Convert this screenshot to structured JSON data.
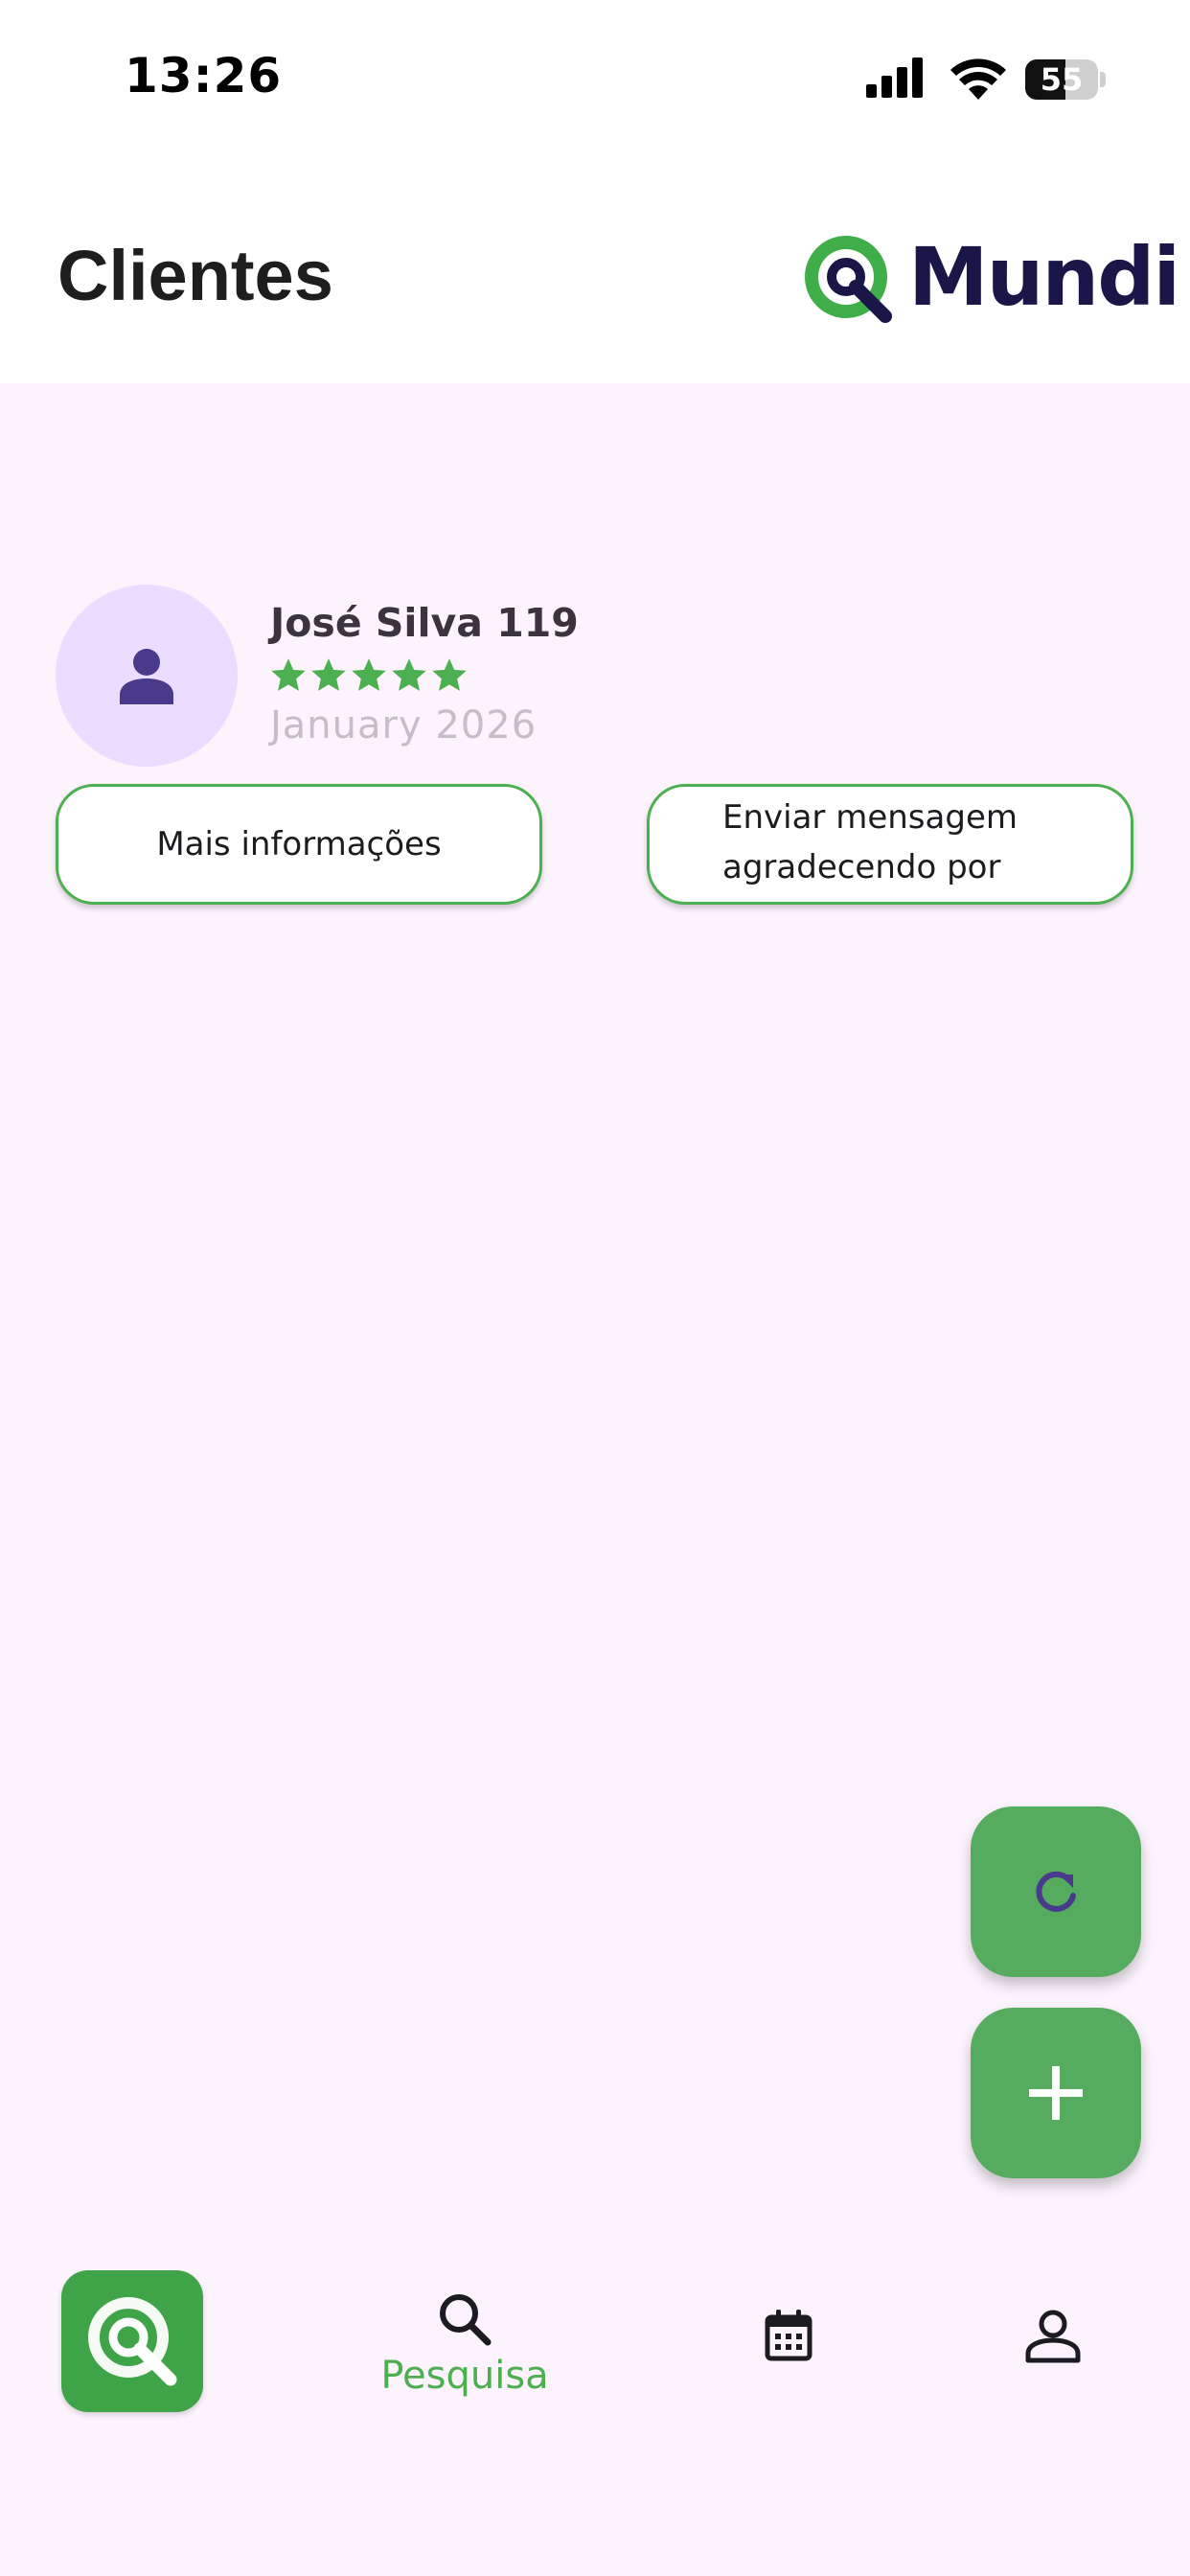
{
  "status_bar": {
    "time": "13:26",
    "battery": "55"
  },
  "header": {
    "title": "Clientes",
    "logo_text": "Mundi"
  },
  "client": {
    "name": "José Silva 119",
    "rating": 5,
    "rating_max": 5,
    "date": "January 2026",
    "more_info_label": "Mais informações",
    "message_label": "Enviar mensagem agradecendo por"
  },
  "fab": {
    "refresh_icon": "refresh-icon",
    "add_icon": "plus-icon"
  },
  "nav": {
    "items": [
      {
        "icon": "mundi-logo-icon",
        "label": ""
      },
      {
        "icon": "search-icon",
        "label": "Pesquisa"
      },
      {
        "icon": "calendar-icon",
        "label": ""
      },
      {
        "icon": "person-icon",
        "label": ""
      }
    ]
  },
  "colors": {
    "brand_green": "#4caf50",
    "brand_navy": "#1a1648",
    "avatar_bg": "#eaddff",
    "icon_purple": "#4a3a8c",
    "page_bg": "#fcf3fc"
  }
}
